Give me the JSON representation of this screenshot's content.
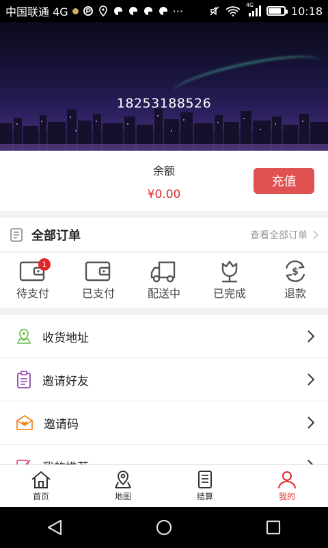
{
  "status_bar": {
    "carrier": "中国联通 4G",
    "overflow": "···",
    "network": "4G",
    "time": "10:18",
    "battery_level": 0.85
  },
  "header": {
    "phone_number": "18253188526"
  },
  "balance": {
    "label": "余额",
    "amount": "¥0.00",
    "recharge_label": "充值"
  },
  "orders": {
    "title": "全部订单",
    "view_all": "查看全部订单",
    "statuses": [
      {
        "label": "待支付",
        "badge": "1"
      },
      {
        "label": "已支付"
      },
      {
        "label": "配送中"
      },
      {
        "label": "已完成"
      },
      {
        "label": "退款"
      }
    ]
  },
  "menu": [
    {
      "label": "收货地址",
      "icon": "location-icon"
    },
    {
      "label": "邀请好友",
      "icon": "clipboard-icon"
    },
    {
      "label": "邀请码",
      "icon": "envelope-heart-icon"
    },
    {
      "label": "我的推荐",
      "icon": "edit-icon"
    }
  ],
  "tabs": [
    {
      "label": "首页",
      "icon": "home-icon"
    },
    {
      "label": "地图",
      "icon": "map-icon"
    },
    {
      "label": "结算",
      "icon": "receipt-icon"
    },
    {
      "label": "我的",
      "icon": "user-icon"
    }
  ],
  "colors": {
    "accent": "#e0262b",
    "recharge_button": "#e05152"
  }
}
